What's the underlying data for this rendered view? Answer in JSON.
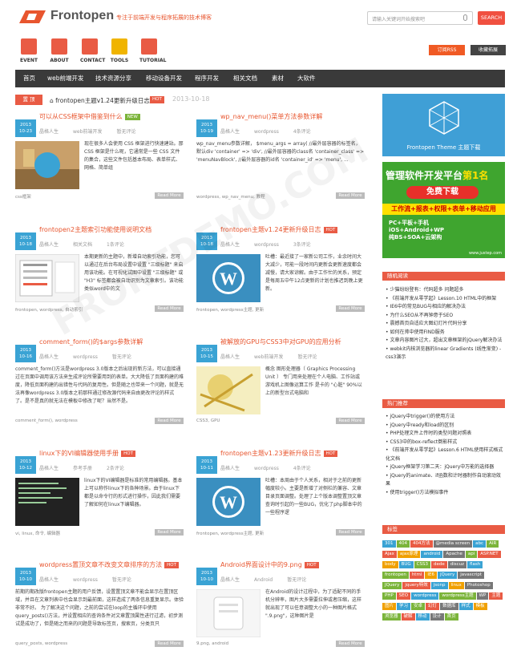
{
  "header": {
    "logo_text": "Frontopen",
    "tagline": "专注于前端开发与程序拓展的技术博客",
    "search_placeholder": "请输入关键词开始搜索吧",
    "search_button": "SEARCH"
  },
  "quick_links": [
    {
      "label": "EVENT",
      "color": "#e95b44"
    },
    {
      "label": "ABOUT",
      "color": "#e95b44"
    },
    {
      "label": "CONTACT",
      "color": "#e95b44"
    },
    {
      "label": "TOOLS",
      "color": "#f0b400"
    },
    {
      "label": "TUTORIAL",
      "color": "#e95b44"
    }
  ],
  "buttons": {
    "subscribe": "订阅RSS",
    "favorite": "收藏拓展"
  },
  "nav": [
    "首页",
    "web前端开发",
    "技术资源分享",
    "移动设备开发",
    "程序开发",
    "相关文档",
    "素材",
    "大软件"
  ],
  "breadcrumb": {
    "home": "置 顶",
    "text": "frontopen主题v1.24更新升级日志",
    "hot": "HOT",
    "date": "2013-10-18"
  },
  "posts": [
    {
      "year": "2013",
      "date": "10-23",
      "title": "可以从CSS框架中借鉴到什么",
      "tag": "NEW",
      "tag_color": "#7bb43a",
      "author": "晶格人生",
      "category": "web前端开发",
      "comments": "暂无评论",
      "thumb": "css",
      "excerpt": "现在很多人会使用 CSS 框架进行快速建站。那 CSS 框架是什么呢，它通常是一些 CSS 文件的集合，这些文件包括基本布局、表单样式、网格、简单组",
      "tags": "css框架",
      "more": "Read More"
    },
    {
      "year": "2013",
      "date": "10-19",
      "title": "wp_nav_menu()菜单方法参数详解",
      "tag": "",
      "tag_color": "",
      "author": "晶格人生",
      "category": "wordpress",
      "comments": "4条评论",
      "thumb": "",
      "excerpt": "wp_nav_menu参数详解，  $menu_args = array( //最外层容器的标签名，默认div  'container' => 'div', //最外层容器的class名  'container_class' => 'menuNavBlock', //最外层容器的id名  'container_id' => 'menu', ...",
      "tags": "wordpress, wp_nav_menu, 教程",
      "more": "Read More"
    },
    {
      "year": "2013",
      "date": "10-18",
      "title": "frontopen2主题索引功能使用说明文档",
      "tag": "",
      "tag_color": "",
      "author": "晶格人生",
      "category": "相关文档",
      "comments": "1条评论",
      "thumb": "menu",
      "excerpt": "本期更新的主题中，新增自动索引功能，您可以通过在后台布局设置中设置 \"三级标题\" 来启用该功能。在可视化试图中设置 \"三级标题\" 或 \"H3\" 标签都会被自动识别为文章索引。该功能类似word中的文",
      "tags": "frontopen, wordpress, 自动索引",
      "more": "Read More"
    },
    {
      "year": "2013",
      "date": "10-18",
      "title": "frontopen主题v1.24更新升级日志",
      "tag": "HOT",
      "tag_color": "#e95b44",
      "author": "晶格人生",
      "category": "wordpress",
      "comments": "3条评论",
      "thumb": "wp",
      "excerpt": "吐槽：最近接了一家新公司工作，业余时间大大减少，可能一段时间内更新会更新速度都会减慢，请大家谅解。由于工作忙的关系，预定是每周五中午12点更新的计划也推迟到晚上更新。",
      "tags": "frontopen, wordpress主题, 更新",
      "more": "Read More"
    },
    {
      "year": "2013",
      "date": "10-16",
      "title": "comment_form()的$args参数详解",
      "tag": "",
      "tag_color": "",
      "author": "晶格人生",
      "category": "wordpress",
      "comments": "暂无评论",
      "thumb": "",
      "excerpt": "comment_form()方法是wordpress 3.0版本之后出现的新方法，可以直接通过在页面中调用该方法来生成评论所需要用到的表单。大大降低了页面构建的难度，降低页面构建的出错性与代码的复用性。但是随之也带来一个问题，就是无法再像wordpress 3.0版本之前那样通过修改源代码来自由更改评论的样式了。是不是真的就无法在模板中修改了呢？当然不是。",
      "tags": "comment_form(), wordpress",
      "more": "Read More"
    },
    {
      "year": "2013",
      "date": "10-15",
      "title": "被解放的GPU与CSS3中对GPU的应用分析",
      "tag": "",
      "tag_color": "",
      "author": "晶格人生",
      "category": "web前端开发",
      "comments": "暂无评论",
      "thumb": "gpu",
      "excerpt": "概念 图形处理器（ Graphics Processing Unit ） 专门用来处理在个人电脑、工作站或游戏机上图像运算工作 是卡的 \"心脏\" 90%以上的新型台式电脑和",
      "tags": "CSS3, GPU",
      "more": "Read More"
    },
    {
      "year": "2013",
      "date": "10-12",
      "title": "linux下的VI编辑器使用手册",
      "tag": "HOT",
      "tag_color": "#e95b44",
      "author": "晶格人生",
      "category": "参考手册",
      "comments": "2条评论",
      "thumb": "vi",
      "excerpt": "linux下的VI编辑器是标准的常用编辑器。基本上可以称作linux下的各种场景。由于linux下都是以命令行的形式进行操作，因此我们需要了解如何在linux下编辑器。",
      "tags": "vi, linux, 命令, 编辑器",
      "more": "Read More"
    },
    {
      "year": "2013",
      "date": "10-11",
      "title": "frontopen主题v1.23更新升级日志",
      "tag": "HOT",
      "tag_color": "#e95b44",
      "author": "晶格人生",
      "category": "wordpress",
      "comments": "4条评论",
      "thumb": "wp",
      "excerpt": "吐槽：本周由于个人关系，相对于之前的更新幅度较小。主要是新增了对侧栏的兼容、文章目录页面调整。处理了上个版本调整置顶文章查询时引起的一些BUG，优化了php脚本中的一些程序逻",
      "tags": "frontopen, wordpress主题, 更新",
      "more": "Read More"
    },
    {
      "year": "2013",
      "date": "10-10",
      "title": "wordpress置顶文章不改变文章排序的方法",
      "tag": "HOT",
      "tag_color": "#e95b44",
      "author": "晶格人生",
      "category": "wordpress",
      "comments": "暂无评论",
      "thumb": "",
      "excerpt": "前期的期改版frontopen主题的用户反馈，设置置顶文章不能会显示在置顶区域，并且在文章列表中也会显示到最前面，这样造成了两条信息重复显示。体验非常不好。 为了解决这个问题，之前的尝试在loop的主循环中使用query_posts()方法，并设置相应的查询条件对文章置顶属性进行过滤，初步测试是成功了，但是随之而来的问题是导致标签页，搜索页，分类页只",
      "tags": "query_posts, wordpress",
      "more": "Read More"
    },
    {
      "year": "2013",
      "date": "10-10",
      "title": "Android界面设计中的9.png",
      "tag": "HOT",
      "tag_color": "#e95b44",
      "author": "晶格人生",
      "category": "Android",
      "comments": "暂无评论",
      "thumb": "android",
      "excerpt": "在Android的设计过程中，为了适配不同的手机分辨率，图片大多需要拉伸或者压缩，这样就出现了可以任意调整大小的一种图片格式 \".9.png\"，这种图片是",
      "tags": "9.png, android",
      "more": "Read More"
    }
  ],
  "sidebar": {
    "banner_text": "Frontopen Theme 主题下载",
    "ad": {
      "title": "管理软件开发平台",
      "rank": "第1名",
      "free": "免费下载",
      "features": "工作流+报表+权限+表单+移动应用",
      "lines": [
        "PC+平板+手机",
        "iOS+Android+WP",
        "纯BS+SOA+云架构"
      ],
      "url": "www.justep.com"
    },
    "random_title": "随机阅读",
    "random": [
      "少猫纷纷登有：代码超多 问题超多",
      "《前端开发从零学起》Lesson.10 HTML中的框架",
      "IE6中的常见BUG与相应的解决办法",
      "为什么SEO从不再钟意于SEO",
      "震撼首页自适应大图幻灯片代码分享",
      "如何在帅中使用FIND服务",
      "文章内容图片过大，超出文章框架的jQuery解决办法",
      "webkit内核浏览器的linear Gradients (线性渐变) -css3演示"
    ],
    "hot_title": "热门推荐",
    "hot": [
      "jQuery中trigger()的使用方法",
      "jQuery中ready和load的区别",
      "PHP处理文件上传时的类型问题对照表",
      "CSS3中的box-reflect倒影样式",
      "《前端开发从零学起》Lesson.6 HTML使用样式格式化文档",
      "jQuery框架学习第二天：jQuery中万能的选择器",
      "jQuery的animate、if函数和计时器制作自动滚动效果",
      "使用trigger()方法模拟事件"
    ],
    "tags_title": "标签",
    "tags": [
      {
        "t": "301",
        "c": "#3aa3d4"
      },
      {
        "t": "404",
        "c": "#7bb43a"
      },
      {
        "t": "404方法",
        "c": "#e95b44"
      },
      {
        "t": "@media screen",
        "c": "#777"
      },
      {
        "t": "abc",
        "c": "#3aa3d4"
      },
      {
        "t": "AIR",
        "c": "#7bb43a"
      },
      {
        "t": "Ajax",
        "c": "#e95b44"
      },
      {
        "t": "ajax原理",
        "c": "#f0a000"
      },
      {
        "t": "android",
        "c": "#3aa3d4"
      },
      {
        "t": "Apache",
        "c": "#777"
      },
      {
        "t": "api",
        "c": "#7bb43a"
      },
      {
        "t": "ASP.NET",
        "c": "#e95b44"
      },
      {
        "t": "body",
        "c": "#f0a000"
      },
      {
        "t": "BUG",
        "c": "#3aa3d4"
      },
      {
        "t": "CSS3",
        "c": "#7bb43a"
      },
      {
        "t": "dede",
        "c": "#e95b44"
      },
      {
        "t": "discuz",
        "c": "#777"
      },
      {
        "t": "flash",
        "c": "#3aa3d4"
      },
      {
        "t": "frontopen",
        "c": "#7bb43a"
      },
      {
        "t": "html",
        "c": "#e95b44"
      },
      {
        "t": "IE6",
        "c": "#f0a000"
      },
      {
        "t": "jQuery",
        "c": "#3aa3d4"
      },
      {
        "t": "javascript",
        "c": "#777"
      },
      {
        "t": "JQuery",
        "c": "#7bb43a"
      },
      {
        "t": "jquery特效",
        "c": "#e95b44"
      },
      {
        "t": "jsonp",
        "c": "#3aa3d4"
      },
      {
        "t": "linux",
        "c": "#f0a000"
      },
      {
        "t": "Photoshop",
        "c": "#777"
      },
      {
        "t": "PHP",
        "c": "#7bb43a"
      },
      {
        "t": "SEO",
        "c": "#e95b44"
      },
      {
        "t": "wordpress",
        "c": "#3aa3d4"
      },
      {
        "t": "wordpress主题",
        "c": "#7bb43a"
      },
      {
        "t": "WP",
        "c": "#777"
      },
      {
        "t": "主题",
        "c": "#e95b44"
      },
      {
        "t": "图片",
        "c": "#f0a000"
      },
      {
        "t": "学习",
        "c": "#3aa3d4"
      },
      {
        "t": "安卓",
        "c": "#7bb43a"
      },
      {
        "t": "幻灯",
        "c": "#e95b44"
      },
      {
        "t": "数据库",
        "c": "#777"
      },
      {
        "t": "样式",
        "c": "#3aa3d4"
      },
      {
        "t": "模板",
        "c": "#f0a000"
      },
      {
        "t": "浏览器",
        "c": "#7bb43a"
      },
      {
        "t": "破解",
        "c": "#e95b44"
      },
      {
        "t": "移动",
        "c": "#3aa3d4"
      },
      {
        "t": "设计",
        "c": "#777"
      },
      {
        "t": "首页",
        "c": "#7bb43a"
      }
    ]
  }
}
